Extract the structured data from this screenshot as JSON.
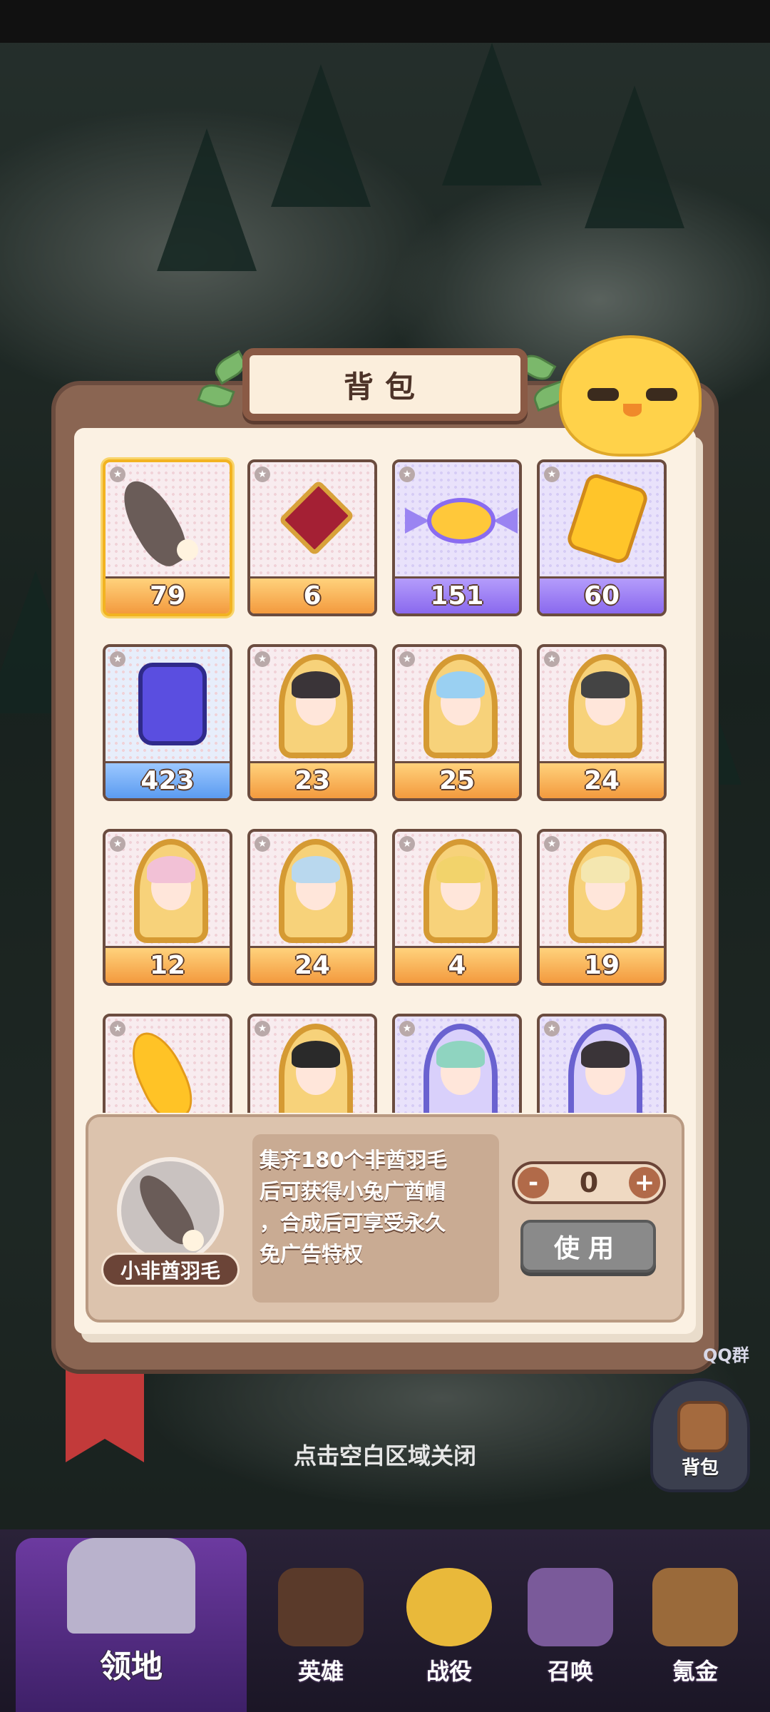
{
  "panel": {
    "title": "背包"
  },
  "items": [
    {
      "count": "79",
      "style": "orange",
      "art": "feather-icon",
      "selected": true
    },
    {
      "count": "6",
      "style": "orange",
      "art": "ruby-icon"
    },
    {
      "count": "151",
      "style": "purple",
      "art": "candy-icon"
    },
    {
      "count": "60",
      "style": "purple",
      "art": "gold-crystal-icon"
    },
    {
      "count": "423",
      "style": "blue",
      "art": "blue-crystal-icon"
    },
    {
      "count": "23",
      "style": "orange",
      "art": "hero-frame-icon"
    },
    {
      "count": "25",
      "style": "orange",
      "art": "hero-frame-icon"
    },
    {
      "count": "24",
      "style": "orange",
      "art": "hero-frame-icon"
    },
    {
      "count": "12",
      "style": "orange",
      "art": "hero-frame-icon"
    },
    {
      "count": "24",
      "style": "orange",
      "art": "hero-frame-icon"
    },
    {
      "count": "4",
      "style": "orange",
      "art": "hero-frame-icon"
    },
    {
      "count": "19",
      "style": "orange",
      "art": "hero-frame-icon"
    },
    {
      "count": "",
      "style": "orange",
      "art": "golden-feather-icon"
    },
    {
      "count": "",
      "style": "orange",
      "art": "hero-frame-icon"
    },
    {
      "count": "",
      "style": "purple",
      "art": "hero-frame-icon"
    },
    {
      "count": "",
      "style": "purple",
      "art": "hero-frame-icon"
    }
  ],
  "detail": {
    "name": "小非酋羽毛",
    "desc_lines": [
      "集齐180个非酋羽毛",
      "后可获得小兔广酋帽",
      "，合成后可享受永久",
      "免广告特权"
    ],
    "quantity": "0",
    "minus": "-",
    "plus": "+",
    "use_label": "使用"
  },
  "close_hint": "点击空白区域关闭",
  "side": {
    "qq_label": "QQ群",
    "bag_label": "背包"
  },
  "nav": [
    {
      "label": "领地",
      "active": true
    },
    {
      "label": "英雄"
    },
    {
      "label": "战役"
    },
    {
      "label": "召唤"
    },
    {
      "label": "氪金"
    }
  ],
  "colors": {
    "panel_brown": "#8a6552",
    "paper": "#fbf1e3",
    "count_orange": "#f39a3e",
    "count_purple": "#8a69ee",
    "count_blue": "#5b9bf0",
    "nav_active": "#6c3aa0"
  }
}
